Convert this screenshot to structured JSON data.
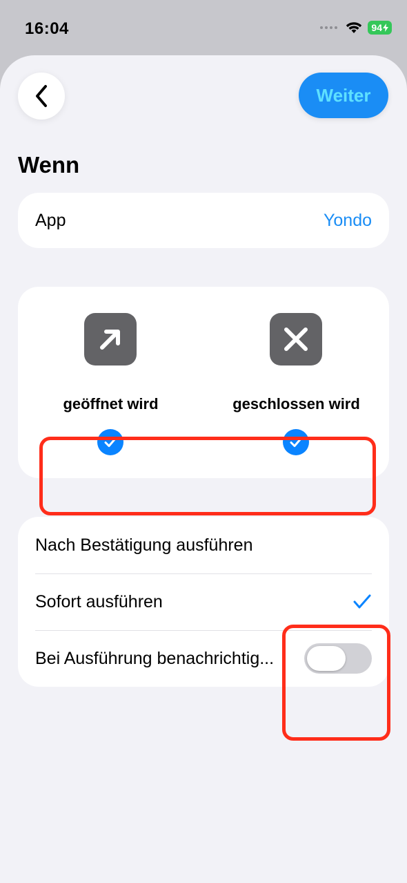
{
  "status_bar": {
    "time": "16:04",
    "battery": "94"
  },
  "header": {
    "back_icon": "chevron-left-icon",
    "next_label": "Weiter"
  },
  "section": {
    "title": "Wenn"
  },
  "app_row": {
    "label": "App",
    "value": "Yondo"
  },
  "events": [
    {
      "label": "geöffnet wird",
      "icon": "arrow-up-right-icon",
      "checked": true
    },
    {
      "label": "geschlossen wird",
      "icon": "close-x-icon",
      "checked": true
    }
  ],
  "options": [
    {
      "label": "Nach Bestätigung ausführen"
    },
    {
      "label": "Sofort ausführen",
      "selected": true
    },
    {
      "label": "Bei Ausführung benachrichtig...",
      "toggle_on": false
    }
  ],
  "colors": {
    "accent": "#1a8df5",
    "highlight": "#ff2d1a",
    "battery": "#34c759"
  }
}
